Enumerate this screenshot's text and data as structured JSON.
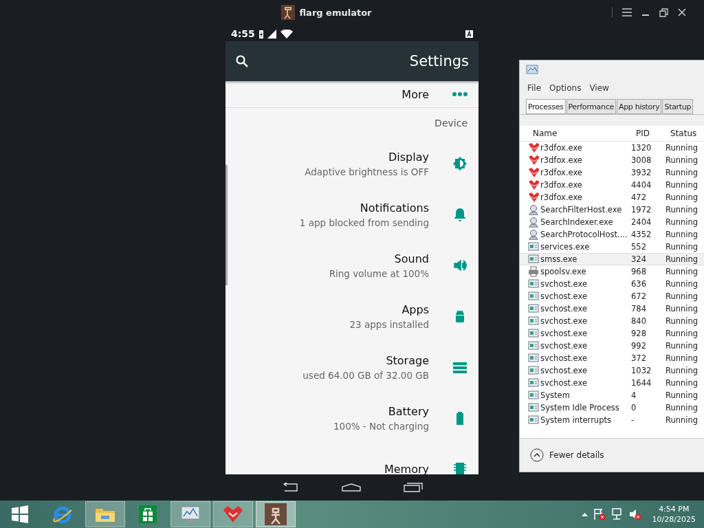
{
  "emulator": {
    "title": "flarg emulator"
  },
  "phone": {
    "status_bar": {
      "time": "4:55"
    },
    "app_bar": {
      "title": "Settings"
    },
    "settings": [
      {
        "kind": "item",
        "title": "More"
      },
      {
        "kind": "header",
        "title": "Device"
      },
      {
        "kind": "item",
        "title": "Display",
        "subtitle": "Adaptive brightness is OFF"
      },
      {
        "kind": "item",
        "title": "Notifications",
        "subtitle": "1 app blocked from sending"
      },
      {
        "kind": "item",
        "title": "Sound",
        "subtitle": "Ring volume at 100%"
      },
      {
        "kind": "item",
        "title": "Apps",
        "subtitle": "23 apps installed"
      },
      {
        "kind": "item",
        "title": "Storage",
        "subtitle": "used 64.00 GB of 32.00 GB"
      },
      {
        "kind": "item",
        "title": "Battery",
        "subtitle": "100% - Not charging"
      },
      {
        "kind": "item",
        "title": "Memory"
      }
    ]
  },
  "task_manager": {
    "menu": [
      "File",
      "Options",
      "View"
    ],
    "tabs": [
      {
        "label": "Processes",
        "selected": true
      },
      {
        "label": "Performance",
        "selected": false
      },
      {
        "label": "App history",
        "selected": false
      },
      {
        "label": "Startup",
        "selected": false
      }
    ],
    "columns": [
      "Name",
      "PID",
      "Status"
    ],
    "rows": [
      {
        "kind": "fox",
        "name": "r3dfox.exe",
        "pid": "1320",
        "status": "Running",
        "selected": false
      },
      {
        "kind": "fox",
        "name": "r3dfox.exe",
        "pid": "3008",
        "status": "Running",
        "selected": false
      },
      {
        "kind": "fox",
        "name": "r3dfox.exe",
        "pid": "3932",
        "status": "Running",
        "selected": false
      },
      {
        "kind": "fox",
        "name": "r3dfox.exe",
        "pid": "4404",
        "status": "Running",
        "selected": false
      },
      {
        "kind": "fox",
        "name": "r3dfox.exe",
        "pid": "472",
        "status": "Running",
        "selected": false
      },
      {
        "kind": "search",
        "name": "SearchFilterHost.exe",
        "pid": "1972",
        "status": "Running",
        "selected": false
      },
      {
        "kind": "search",
        "name": "SearchIndexer.exe",
        "pid": "2404",
        "status": "Running",
        "selected": false
      },
      {
        "kind": "search",
        "name": "SearchProtocolHost....",
        "pid": "4352",
        "status": "Running",
        "selected": false
      },
      {
        "kind": "service",
        "name": "services.exe",
        "pid": "552",
        "status": "Running",
        "selected": false
      },
      {
        "kind": "service",
        "name": "smss.exe",
        "pid": "324",
        "status": "Running",
        "selected": true
      },
      {
        "kind": "printer",
        "name": "spoolsv.exe",
        "pid": "968",
        "status": "Running",
        "selected": false
      },
      {
        "kind": "service",
        "name": "svchost.exe",
        "pid": "636",
        "status": "Running",
        "selected": false
      },
      {
        "kind": "service",
        "name": "svchost.exe",
        "pid": "672",
        "status": "Running",
        "selected": false
      },
      {
        "kind": "service",
        "name": "svchost.exe",
        "pid": "784",
        "status": "Running",
        "selected": false
      },
      {
        "kind": "service",
        "name": "svchost.exe",
        "pid": "840",
        "status": "Running",
        "selected": false
      },
      {
        "kind": "service",
        "name": "svchost.exe",
        "pid": "928",
        "status": "Running",
        "selected": false
      },
      {
        "kind": "service",
        "name": "svchost.exe",
        "pid": "992",
        "status": "Running",
        "selected": false
      },
      {
        "kind": "service",
        "name": "svchost.exe",
        "pid": "372",
        "status": "Running",
        "selected": false
      },
      {
        "kind": "service",
        "name": "svchost.exe",
        "pid": "1032",
        "status": "Running",
        "selected": false
      },
      {
        "kind": "service",
        "name": "svchost.exe",
        "pid": "1644",
        "status": "Running",
        "selected": false
      },
      {
        "kind": "service",
        "name": "System",
        "pid": "4",
        "status": "Running",
        "selected": false
      },
      {
        "kind": "service",
        "name": "System Idle Process",
        "pid": "0",
        "status": "Running",
        "selected": false
      },
      {
        "kind": "service",
        "name": "System interrupts",
        "pid": "-",
        "status": "Running",
        "selected": false
      }
    ],
    "footer": "Fewer details"
  },
  "taskbar": {
    "time": "4:54 PM",
    "date": "10/28/2025"
  }
}
